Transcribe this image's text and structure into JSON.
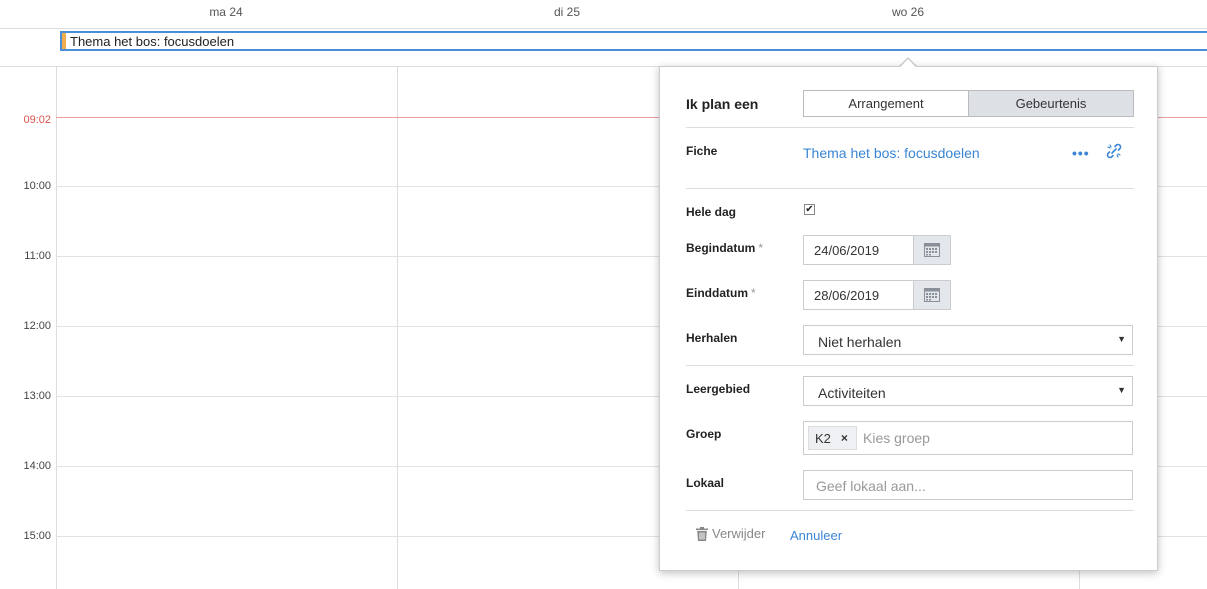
{
  "calendar": {
    "days": [
      "ma 24",
      "di 25",
      "wo 26"
    ],
    "allday_event": "Thema het bos: focusdoelen",
    "times": [
      "10:00",
      "11:00",
      "12:00",
      "13:00",
      "14:00",
      "15:00"
    ],
    "now": "09:02"
  },
  "popover": {
    "title": "Ik plan een",
    "segments": [
      "Arrangement",
      "Gebeurtenis"
    ],
    "active_segment": "Gebeurtenis",
    "fiche": {
      "label": "Fiche",
      "link": "Thema het bos: focusdoelen",
      "more": "•••"
    },
    "hele_dag": {
      "label": "Hele dag",
      "checked": true,
      "check": "✔"
    },
    "begindatum": {
      "label": "Begindatum",
      "required": "*",
      "value": "24/06/2019"
    },
    "einddatum": {
      "label": "Einddatum",
      "required": "*",
      "value": "28/06/2019"
    },
    "herhalen": {
      "label": "Herhalen",
      "value": "Niet herhalen",
      "caret": "▼"
    },
    "leergebied": {
      "label": "Leergebied",
      "value": "Activiteiten",
      "caret": "▼"
    },
    "groep": {
      "label": "Groep",
      "chip": "K2",
      "chip_remove": "×",
      "placeholder": "Kies groep"
    },
    "lokaal": {
      "label": "Lokaal",
      "placeholder": "Geef lokaal aan..."
    },
    "delete_label": "Verwijder",
    "cancel_label": "Annuleer"
  },
  "colors": {
    "accent": "#3a85d4",
    "event_border": "#4a90d9",
    "event_accent": "#f0ad4e",
    "now_line": "#d9534f"
  }
}
